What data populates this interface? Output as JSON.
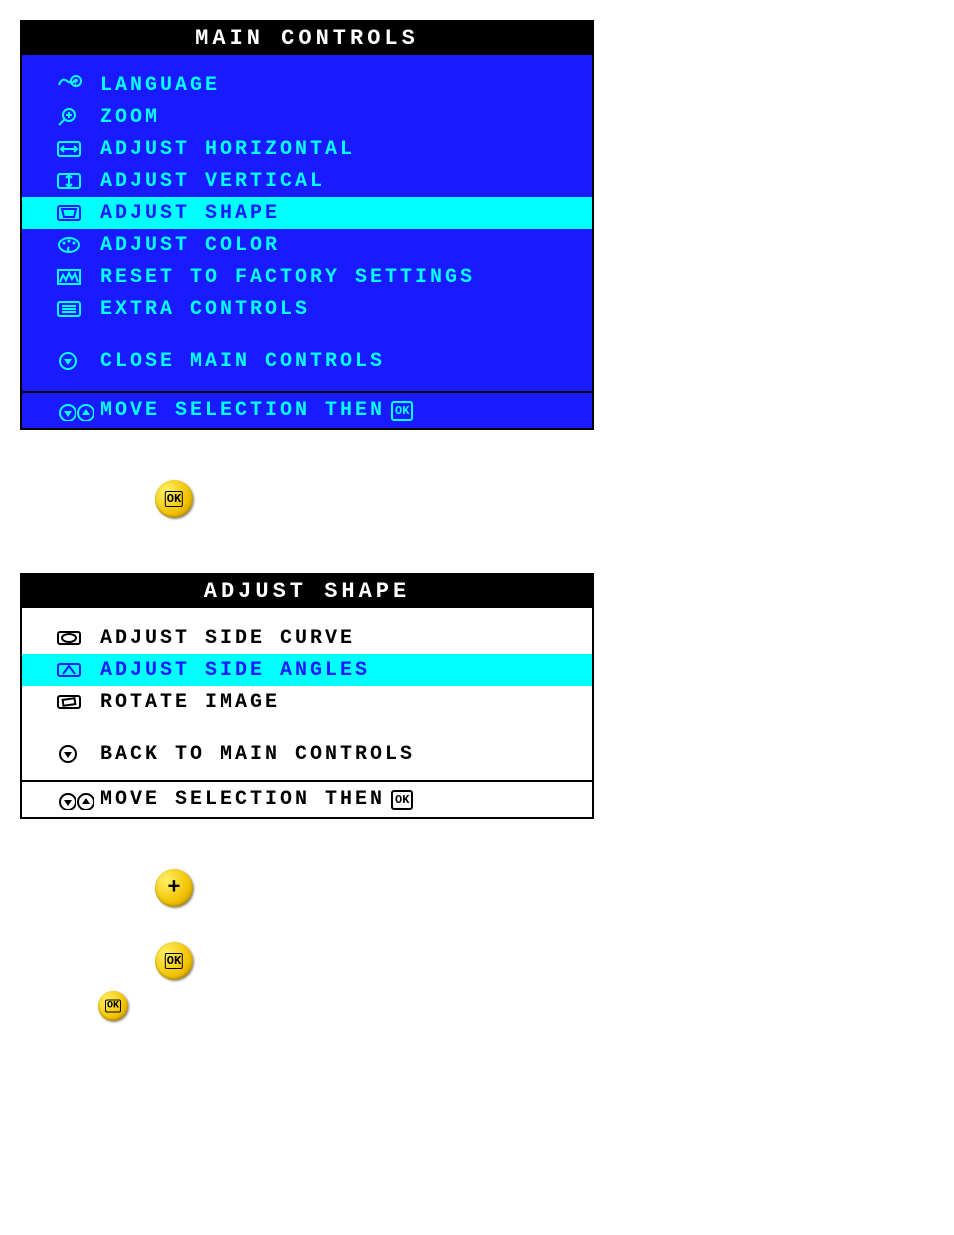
{
  "main_panel": {
    "title": "MAIN CONTROLS",
    "items": [
      {
        "icon": "language-icon",
        "label": "LANGUAGE",
        "selected": false
      },
      {
        "icon": "zoom-icon",
        "label": "ZOOM",
        "selected": false
      },
      {
        "icon": "adjust-horizontal-icon",
        "label": "ADJUST HORIZONTAL",
        "selected": false
      },
      {
        "icon": "adjust-vertical-icon",
        "label": "ADJUST VERTICAL",
        "selected": false
      },
      {
        "icon": "adjust-shape-icon",
        "label": "ADJUST SHAPE",
        "selected": true
      },
      {
        "icon": "adjust-color-icon",
        "label": "ADJUST COLOR",
        "selected": false
      },
      {
        "icon": "reset-factory-icon",
        "label": "RESET TO FACTORY SETTINGS",
        "selected": false
      },
      {
        "icon": "extra-controls-icon",
        "label": "EXTRA CONTROLS",
        "selected": false
      }
    ],
    "close_label": "CLOSE MAIN CONTROLS",
    "footer_text": "MOVE SELECTION THEN",
    "footer_ok": "OK"
  },
  "shape_panel": {
    "title": "ADJUST SHAPE",
    "items": [
      {
        "icon": "side-curve-icon",
        "label": "ADJUST SIDE CURVE",
        "selected": false
      },
      {
        "icon": "side-angles-icon",
        "label": "ADJUST SIDE ANGLES",
        "selected": true
      },
      {
        "icon": "rotate-image-icon",
        "label": "ROTATE IMAGE",
        "selected": false
      }
    ],
    "back_label": "BACK TO MAIN CONTROLS",
    "footer_text": "MOVE SELECTION THEN",
    "footer_ok": "OK"
  },
  "buttons": {
    "ok1": "OK",
    "plus": "+",
    "ok2": "OK",
    "ok3": "OK"
  }
}
